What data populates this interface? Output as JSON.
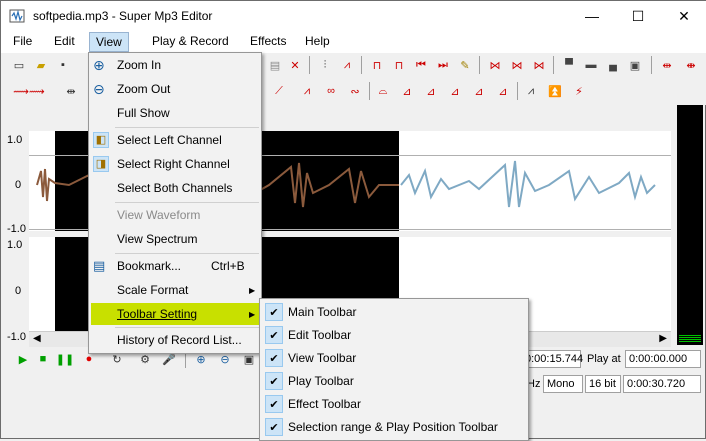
{
  "window": {
    "title": "softpedia.mp3 - Super Mp3 Editor",
    "minimize_glyph": "—",
    "maximize_glyph": "☐",
    "close_glyph": "✕"
  },
  "menubar": {
    "items": [
      "File",
      "Edit",
      "View",
      "Play & Record",
      "Effects",
      "Help"
    ]
  },
  "axis": {
    "top_channel": [
      "1.0",
      "0",
      "-1.0"
    ],
    "bottom_channel": [
      "1.0",
      "0",
      "-1.0"
    ]
  },
  "status": {
    "time1": "0:00:15.744",
    "play_at_label": "Play at",
    "play_at_value": "0:00:00.000",
    "hz_suffix": "Hz",
    "mode": "Mono",
    "bits": "16 bit",
    "duration": "0:00:30.720"
  },
  "view_menu": {
    "items": [
      {
        "label": "Zoom In",
        "icon": "zoom-in-icon"
      },
      {
        "label": "Zoom Out",
        "icon": "zoom-out-icon"
      },
      {
        "label": "Full Show",
        "icon": ""
      },
      {
        "label": "Select Left Channel",
        "icon": "left-channel-icon"
      },
      {
        "label": "Select Right Channel",
        "icon": "right-channel-icon"
      },
      {
        "label": "Select Both Channels",
        "icon": ""
      },
      {
        "label": "View Waveform",
        "icon": "",
        "disabled": true
      },
      {
        "label": "View Spectrum",
        "icon": ""
      },
      {
        "label": "Bookmark...",
        "shortcut": "Ctrl+B",
        "icon": "bookmark-icon"
      },
      {
        "label": "Scale Format",
        "submenu": true
      },
      {
        "label": "Toolbar Setting",
        "submenu": true,
        "highlighted": true
      },
      {
        "label": "History of Record List..."
      }
    ]
  },
  "toolbar_submenu": {
    "items": [
      {
        "label": "Main Toolbar",
        "checked": true
      },
      {
        "label": "Edit Toolbar",
        "checked": true
      },
      {
        "label": "View Toolbar",
        "checked": true
      },
      {
        "label": "Play Toolbar",
        "checked": true
      },
      {
        "label": "Effect Toolbar",
        "checked": true
      },
      {
        "label": "Selection range & Play Position Toolbar",
        "checked": true
      }
    ]
  },
  "colors": {
    "highlight": "#c8e000",
    "wave_selected": "#8b5a3c",
    "wave_normal": "#7fa9c4",
    "play_green": "#00a000",
    "record_red": "#e00000"
  }
}
